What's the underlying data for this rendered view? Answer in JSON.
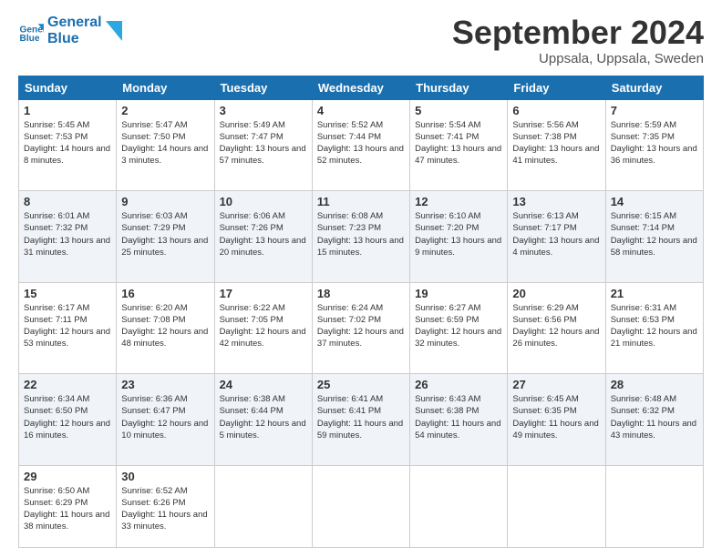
{
  "header": {
    "logo_line1": "General",
    "logo_line2": "Blue",
    "month": "September 2024",
    "location": "Uppsala, Uppsala, Sweden"
  },
  "weekdays": [
    "Sunday",
    "Monday",
    "Tuesday",
    "Wednesday",
    "Thursday",
    "Friday",
    "Saturday"
  ],
  "weeks": [
    [
      {
        "day": "1",
        "sunrise": "5:45 AM",
        "sunset": "7:53 PM",
        "daylight": "14 hours and 8 minutes."
      },
      {
        "day": "2",
        "sunrise": "5:47 AM",
        "sunset": "7:50 PM",
        "daylight": "14 hours and 3 minutes."
      },
      {
        "day": "3",
        "sunrise": "5:49 AM",
        "sunset": "7:47 PM",
        "daylight": "13 hours and 57 minutes."
      },
      {
        "day": "4",
        "sunrise": "5:52 AM",
        "sunset": "7:44 PM",
        "daylight": "13 hours and 52 minutes."
      },
      {
        "day": "5",
        "sunrise": "5:54 AM",
        "sunset": "7:41 PM",
        "daylight": "13 hours and 47 minutes."
      },
      {
        "day": "6",
        "sunrise": "5:56 AM",
        "sunset": "7:38 PM",
        "daylight": "13 hours and 41 minutes."
      },
      {
        "day": "7",
        "sunrise": "5:59 AM",
        "sunset": "7:35 PM",
        "daylight": "13 hours and 36 minutes."
      }
    ],
    [
      {
        "day": "8",
        "sunrise": "6:01 AM",
        "sunset": "7:32 PM",
        "daylight": "13 hours and 31 minutes."
      },
      {
        "day": "9",
        "sunrise": "6:03 AM",
        "sunset": "7:29 PM",
        "daylight": "13 hours and 25 minutes."
      },
      {
        "day": "10",
        "sunrise": "6:06 AM",
        "sunset": "7:26 PM",
        "daylight": "13 hours and 20 minutes."
      },
      {
        "day": "11",
        "sunrise": "6:08 AM",
        "sunset": "7:23 PM",
        "daylight": "13 hours and 15 minutes."
      },
      {
        "day": "12",
        "sunrise": "6:10 AM",
        "sunset": "7:20 PM",
        "daylight": "13 hours and 9 minutes."
      },
      {
        "day": "13",
        "sunrise": "6:13 AM",
        "sunset": "7:17 PM",
        "daylight": "13 hours and 4 minutes."
      },
      {
        "day": "14",
        "sunrise": "6:15 AM",
        "sunset": "7:14 PM",
        "daylight": "12 hours and 58 minutes."
      }
    ],
    [
      {
        "day": "15",
        "sunrise": "6:17 AM",
        "sunset": "7:11 PM",
        "daylight": "12 hours and 53 minutes."
      },
      {
        "day": "16",
        "sunrise": "6:20 AM",
        "sunset": "7:08 PM",
        "daylight": "12 hours and 48 minutes."
      },
      {
        "day": "17",
        "sunrise": "6:22 AM",
        "sunset": "7:05 PM",
        "daylight": "12 hours and 42 minutes."
      },
      {
        "day": "18",
        "sunrise": "6:24 AM",
        "sunset": "7:02 PM",
        "daylight": "12 hours and 37 minutes."
      },
      {
        "day": "19",
        "sunrise": "6:27 AM",
        "sunset": "6:59 PM",
        "daylight": "12 hours and 32 minutes."
      },
      {
        "day": "20",
        "sunrise": "6:29 AM",
        "sunset": "6:56 PM",
        "daylight": "12 hours and 26 minutes."
      },
      {
        "day": "21",
        "sunrise": "6:31 AM",
        "sunset": "6:53 PM",
        "daylight": "12 hours and 21 minutes."
      }
    ],
    [
      {
        "day": "22",
        "sunrise": "6:34 AM",
        "sunset": "6:50 PM",
        "daylight": "12 hours and 16 minutes."
      },
      {
        "day": "23",
        "sunrise": "6:36 AM",
        "sunset": "6:47 PM",
        "daylight": "12 hours and 10 minutes."
      },
      {
        "day": "24",
        "sunrise": "6:38 AM",
        "sunset": "6:44 PM",
        "daylight": "12 hours and 5 minutes."
      },
      {
        "day": "25",
        "sunrise": "6:41 AM",
        "sunset": "6:41 PM",
        "daylight": "11 hours and 59 minutes."
      },
      {
        "day": "26",
        "sunrise": "6:43 AM",
        "sunset": "6:38 PM",
        "daylight": "11 hours and 54 minutes."
      },
      {
        "day": "27",
        "sunrise": "6:45 AM",
        "sunset": "6:35 PM",
        "daylight": "11 hours and 49 minutes."
      },
      {
        "day": "28",
        "sunrise": "6:48 AM",
        "sunset": "6:32 PM",
        "daylight": "11 hours and 43 minutes."
      }
    ],
    [
      {
        "day": "29",
        "sunrise": "6:50 AM",
        "sunset": "6:29 PM",
        "daylight": "11 hours and 38 minutes."
      },
      {
        "day": "30",
        "sunrise": "6:52 AM",
        "sunset": "6:26 PM",
        "daylight": "11 hours and 33 minutes."
      },
      null,
      null,
      null,
      null,
      null
    ]
  ],
  "labels": {
    "sunrise": "Sunrise:",
    "sunset": "Sunset:",
    "daylight": "Daylight:"
  }
}
